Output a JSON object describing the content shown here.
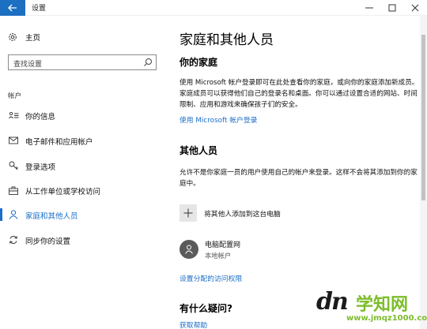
{
  "window": {
    "title": "设置",
    "back_icon": "arrow-left-icon",
    "accent": "#1c6fc1"
  },
  "sidebar": {
    "home_label": "主页",
    "search_placeholder": "查找设置",
    "section_label": "帐户",
    "items": [
      {
        "label": "你的信息",
        "icon": "user-card-icon",
        "active": false
      },
      {
        "label": "电子邮件和应用帐户",
        "icon": "mail-icon",
        "active": false
      },
      {
        "label": "登录选项",
        "icon": "key-icon",
        "active": false
      },
      {
        "label": "从工作单位或学校访问",
        "icon": "briefcase-icon",
        "active": false
      },
      {
        "label": "家庭和其他人员",
        "icon": "person-icon",
        "active": true
      },
      {
        "label": "同步你的设置",
        "icon": "sync-icon",
        "active": false
      }
    ]
  },
  "main": {
    "title": "家庭和其他人员",
    "family": {
      "heading": "你的家庭",
      "description": "使用 Microsoft 帐户登录即可在此处查看你的家庭，或向你的家庭添加新成员。家庭成员可以获得他们自己的登录名和桌面。你可以通过设置合适的网站、时间限制、应用和游戏来确保孩子们的安全。",
      "link": "使用 Microsoft 帐户登录"
    },
    "others": {
      "heading": "其他人员",
      "description": "允许不是你家庭一员的用户使用自己的帐户来登录。这样不会将其添加到你的家庭中。",
      "add_label": "将其他人添加到这台电脑",
      "user": {
        "name": "电脑配置网",
        "type": "本地帐户"
      },
      "link": "设置分配的访问权限"
    },
    "question": {
      "heading": "有什么疑问?",
      "link": "获取帮助"
    }
  },
  "watermark": {
    "logo": "dn",
    "text": "学知网",
    "url": "www.jmqz1000.com"
  }
}
